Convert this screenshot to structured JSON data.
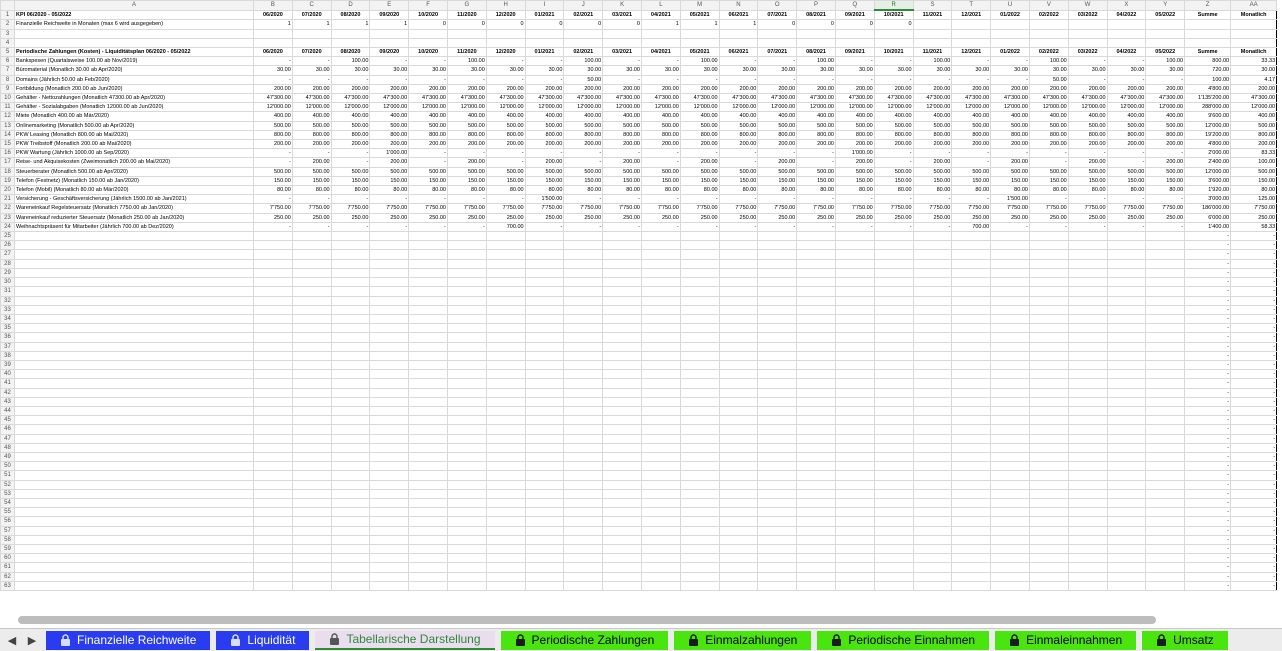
{
  "sheet": {
    "columns": [
      "A",
      "B",
      "C",
      "D",
      "E",
      "F",
      "G",
      "H",
      "I",
      "J",
      "K",
      "L",
      "M",
      "N",
      "O",
      "P",
      "Q",
      "R",
      "S",
      "T",
      "U",
      "V",
      "W",
      "X",
      "Y",
      "Z",
      "AA"
    ],
    "selected_column": "R",
    "months": [
      "06/2020",
      "07/2020",
      "08/2020",
      "09/2020",
      "10/2020",
      "11/2020",
      "12/2020",
      "01/2021",
      "02/2021",
      "03/2021",
      "04/2021",
      "05/2021",
      "06/2021",
      "07/2021",
      "08/2021",
      "09/2021",
      "10/2021",
      "11/2021",
      "12/2021",
      "01/2022",
      "02/2022",
      "03/2022",
      "04/2022",
      "05/2022"
    ],
    "sum_label": "Summe",
    "monthly_label": "Monatlich",
    "kpi_title": "KPI 06/2020 - 05/2022",
    "reach_label": "Finanzielle Reichweite in Monaten (max 6 wird ausgegeben)",
    "reach_values": [
      "1",
      "1",
      "1",
      "1",
      "0",
      "0",
      "0",
      "0",
      "0",
      "0",
      "1",
      "1",
      "1",
      "0",
      "0",
      "0",
      "0",
      ""
    ],
    "periodic_title": "Periodische Zahlungen (Kosten) - Liquiditätsplan 06/2020 - 05/2022",
    "rows": [
      {
        "label": "Bankspesen (Quartalsweise 100.00 ab Nov/2019)",
        "values": [
          "-",
          "-",
          "100.00",
          "-",
          "-",
          "100.00",
          "-",
          "-",
          "100.00",
          "-",
          "-",
          "100.00",
          "-",
          "-",
          "100.00",
          "-",
          "-",
          "100.00",
          "-",
          "-",
          "100.00",
          "-",
          "-",
          "100.00"
        ],
        "sum": "800.00",
        "monthly": "33.33"
      },
      {
        "label": "Büromaterial (Monatlich 30.00 ab Apr/2020)",
        "values": [
          "30.00",
          "30.00",
          "30.00",
          "30.00",
          "30.00",
          "30.00",
          "30.00",
          "30.00",
          "30.00",
          "30.00",
          "30.00",
          "30.00",
          "30.00",
          "30.00",
          "30.00",
          "30.00",
          "30.00",
          "30.00",
          "30.00",
          "30.00",
          "30.00",
          "30.00",
          "30.00",
          "30.00"
        ],
        "sum": "720.00",
        "monthly": "30.00"
      },
      {
        "label": "Domains (Jährlich 50.00 ab Feb/2020)",
        "values": [
          "-",
          "-",
          "-",
          "-",
          "-",
          "-",
          "-",
          "-",
          "50.00",
          "-",
          "-",
          "-",
          "-",
          "-",
          "-",
          "-",
          "-",
          "-",
          "-",
          "-",
          "50.00",
          "-",
          "-",
          "-"
        ],
        "sum": "100.00",
        "monthly": "4.17"
      },
      {
        "label": "Fortbildung (Monatlich 200.00 ab Jun/2020)",
        "values": [
          "200.00",
          "200.00",
          "200.00",
          "200.00",
          "200.00",
          "200.00",
          "200.00",
          "200.00",
          "200.00",
          "200.00",
          "200.00",
          "200.00",
          "200.00",
          "200.00",
          "200.00",
          "200.00",
          "200.00",
          "200.00",
          "200.00",
          "200.00",
          "200.00",
          "200.00",
          "200.00",
          "200.00"
        ],
        "sum": "4'800.00",
        "monthly": "200.00"
      },
      {
        "label": "Gehälter - Nettozahlungen (Monatlich 47300.00 ab Apr/2020)",
        "values": [
          "47'300.00",
          "47'300.00",
          "47'300.00",
          "47'300.00",
          "47'300.00",
          "47'300.00",
          "47'300.00",
          "47'300.00",
          "47'300.00",
          "47'300.00",
          "47'300.00",
          "47'300.00",
          "47'300.00",
          "47'300.00",
          "47'300.00",
          "47'300.00",
          "47'300.00",
          "47'300.00",
          "47'300.00",
          "47'300.00",
          "47'300.00",
          "47'300.00",
          "47'300.00",
          "47'300.00"
        ],
        "sum": "1'135'200.00",
        "monthly": "47'300.00"
      },
      {
        "label": "Gehälter - Sozialabgaben (Monatlich 12000.00 ab Jun/2020)",
        "values": [
          "12'000.00",
          "12'000.00",
          "12'000.00",
          "12'000.00",
          "12'000.00",
          "12'000.00",
          "12'000.00",
          "12'000.00",
          "12'000.00",
          "12'000.00",
          "12'000.00",
          "12'000.00",
          "12'000.00",
          "12'000.00",
          "12'000.00",
          "12'000.00",
          "12'000.00",
          "12'000.00",
          "12'000.00",
          "12'000.00",
          "12'000.00",
          "12'000.00",
          "12'000.00",
          "12'000.00"
        ],
        "sum": "288'000.00",
        "monthly": "12'000.00"
      },
      {
        "label": "Miete (Monatlich 400.00 ab Mär/2020)",
        "values": [
          "400.00",
          "400.00",
          "400.00",
          "400.00",
          "400.00",
          "400.00",
          "400.00",
          "400.00",
          "400.00",
          "400.00",
          "400.00",
          "400.00",
          "400.00",
          "400.00",
          "400.00",
          "400.00",
          "400.00",
          "400.00",
          "400.00",
          "400.00",
          "400.00",
          "400.00",
          "400.00",
          "400.00"
        ],
        "sum": "9'600.00",
        "monthly": "400.00"
      },
      {
        "label": "Onlinemarketing (Monatlich 500.00 ab Apr/2020)",
        "values": [
          "500.00",
          "500.00",
          "500.00",
          "500.00",
          "500.00",
          "500.00",
          "500.00",
          "500.00",
          "500.00",
          "500.00",
          "500.00",
          "500.00",
          "500.00",
          "500.00",
          "500.00",
          "500.00",
          "500.00",
          "500.00",
          "500.00",
          "500.00",
          "500.00",
          "500.00",
          "500.00",
          "500.00"
        ],
        "sum": "12'000.00",
        "monthly": "500.00"
      },
      {
        "label": "PKW Leasing (Monatlich 800.00 ab Mai/2020)",
        "values": [
          "800.00",
          "800.00",
          "800.00",
          "800.00",
          "800.00",
          "800.00",
          "800.00",
          "800.00",
          "800.00",
          "800.00",
          "800.00",
          "800.00",
          "800.00",
          "800.00",
          "800.00",
          "800.00",
          "800.00",
          "800.00",
          "800.00",
          "800.00",
          "800.00",
          "800.00",
          "800.00",
          "800.00"
        ],
        "sum": "19'200.00",
        "monthly": "800.00"
      },
      {
        "label": "PKW Treibstoff (Monatlich 200.00 ab Mai/2020)",
        "values": [
          "200.00",
          "200.00",
          "200.00",
          "200.00",
          "200.00",
          "200.00",
          "200.00",
          "200.00",
          "200.00",
          "200.00",
          "200.00",
          "200.00",
          "200.00",
          "200.00",
          "200.00",
          "200.00",
          "200.00",
          "200.00",
          "200.00",
          "200.00",
          "200.00",
          "200.00",
          "200.00",
          "200.00"
        ],
        "sum": "4'800.00",
        "monthly": "200.00"
      },
      {
        "label": "PKW Wartung (Jährlich 1000.00 ab Sep/2020)",
        "values": [
          "-",
          "-",
          "-",
          "1'000.00",
          "-",
          "-",
          "-",
          "-",
          "-",
          "-",
          "-",
          "-",
          "-",
          "-",
          "-",
          "1'000.00",
          "-",
          "-",
          "-",
          "-",
          "-",
          "-",
          "-",
          "-"
        ],
        "sum": "2'000.00",
        "monthly": "83.33"
      },
      {
        "label": "Reise- und Akquisekosten (Zweimonatlich 200.00 ab Mai/2020)",
        "values": [
          "-",
          "200.00",
          "-",
          "200.00",
          "-",
          "200.00",
          "-",
          "200.00",
          "-",
          "200.00",
          "-",
          "200.00",
          "-",
          "200.00",
          "-",
          "200.00",
          "-",
          "200.00",
          "-",
          "200.00",
          "-",
          "200.00",
          "-",
          "200.00"
        ],
        "sum": "2'400.00",
        "monthly": "100.00"
      },
      {
        "label": "Steuerberater (Monatlich 500.00 ab Apr/2020)",
        "values": [
          "500.00",
          "500.00",
          "500.00",
          "500.00",
          "500.00",
          "500.00",
          "500.00",
          "500.00",
          "500.00",
          "500.00",
          "500.00",
          "500.00",
          "500.00",
          "500.00",
          "500.00",
          "500.00",
          "500.00",
          "500.00",
          "500.00",
          "500.00",
          "500.00",
          "500.00",
          "500.00",
          "500.00"
        ],
        "sum": "12'000.00",
        "monthly": "500.00"
      },
      {
        "label": "Telefon (Festnetz) (Monatlich 150.00 ab Jan/2020)",
        "values": [
          "150.00",
          "150.00",
          "150.00",
          "150.00",
          "150.00",
          "150.00",
          "150.00",
          "150.00",
          "150.00",
          "150.00",
          "150.00",
          "150.00",
          "150.00",
          "150.00",
          "150.00",
          "150.00",
          "150.00",
          "150.00",
          "150.00",
          "150.00",
          "150.00",
          "150.00",
          "150.00",
          "150.00"
        ],
        "sum": "3'600.00",
        "monthly": "150.00"
      },
      {
        "label": "Telefon (Mobil) (Monatlich 80.00 ab Mär/2020)",
        "values": [
          "80.00",
          "80.00",
          "80.00",
          "80.00",
          "80.00",
          "80.00",
          "80.00",
          "80.00",
          "80.00",
          "80.00",
          "80.00",
          "80.00",
          "80.00",
          "80.00",
          "80.00",
          "80.00",
          "80.00",
          "80.00",
          "80.00",
          "80.00",
          "80.00",
          "80.00",
          "80.00",
          "80.00"
        ],
        "sum": "1'920.00",
        "monthly": "80.00"
      },
      {
        "label": "Versicherung - Geschäftsversicherung (Jährlich 1500.00 ab Jan/2021)",
        "values": [
          "-",
          "-",
          "-",
          "-",
          "-",
          "-",
          "-",
          "1'500.00",
          "-",
          "-",
          "-",
          "-",
          "-",
          "-",
          "-",
          "-",
          "-",
          "-",
          "-",
          "1'500.00",
          "-",
          "-",
          "-",
          "-"
        ],
        "sum": "3'000.00",
        "monthly": "125.00"
      },
      {
        "label": "Wareneinkauf Regelsteuersatz (Monatlich 7750.00 ab Jan/2020)",
        "values": [
          "7'750.00",
          "7'750.00",
          "7'750.00",
          "7'750.00",
          "7'750.00",
          "7'750.00",
          "7'750.00",
          "7'750.00",
          "7'750.00",
          "7'750.00",
          "7'750.00",
          "7'750.00",
          "7'750.00",
          "7'750.00",
          "7'750.00",
          "7'750.00",
          "7'750.00",
          "7'750.00",
          "7'750.00",
          "7'750.00",
          "7'750.00",
          "7'750.00",
          "7'750.00",
          "7'750.00"
        ],
        "sum": "186'000.00",
        "monthly": "7'750.00"
      },
      {
        "label": "Wareneinkauf reduzierter Steuersatz (Monatlich 250.00 ab Jan/2020)",
        "values": [
          "250.00",
          "250.00",
          "250.00",
          "250.00",
          "250.00",
          "250.00",
          "250.00",
          "250.00",
          "250.00",
          "250.00",
          "250.00",
          "250.00",
          "250.00",
          "250.00",
          "250.00",
          "250.00",
          "250.00",
          "250.00",
          "250.00",
          "250.00",
          "250.00",
          "250.00",
          "250.00",
          "250.00"
        ],
        "sum": "6'000.00",
        "monthly": "250.00"
      },
      {
        "label": "Weihnachtspräsent für Mitarbeiter (Jährlich 700.00 ab Dez/2020)",
        "values": [
          "-",
          "-",
          "-",
          "-",
          "-",
          "-",
          "700.00",
          "-",
          "-",
          "-",
          "-",
          "-",
          "-",
          "-",
          "-",
          "-",
          "-",
          "-",
          "700.00",
          "-",
          "-",
          "-",
          "-",
          "-"
        ],
        "sum": "1'400.00",
        "monthly": "58.33"
      }
    ],
    "empty_row_count": 39,
    "dash": "-"
  },
  "tabs": [
    {
      "label": "Finanzielle Reichweite",
      "style": "blue"
    },
    {
      "label": "Liquidität",
      "style": "blue"
    },
    {
      "label": "Tabellarische Darstellung",
      "style": "active"
    },
    {
      "label": "Periodische Zahlungen",
      "style": "green"
    },
    {
      "label": "Einmalzahlungen",
      "style": "green"
    },
    {
      "label": "Periodische Einnahmen",
      "style": "green"
    },
    {
      "label": "Einmaleinnahmen",
      "style": "green"
    },
    {
      "label": "Umsatz",
      "style": "green"
    }
  ],
  "nav": {
    "prev": "◀",
    "next": "▶"
  },
  "icons": {
    "tab_lock": "lock-icon"
  }
}
